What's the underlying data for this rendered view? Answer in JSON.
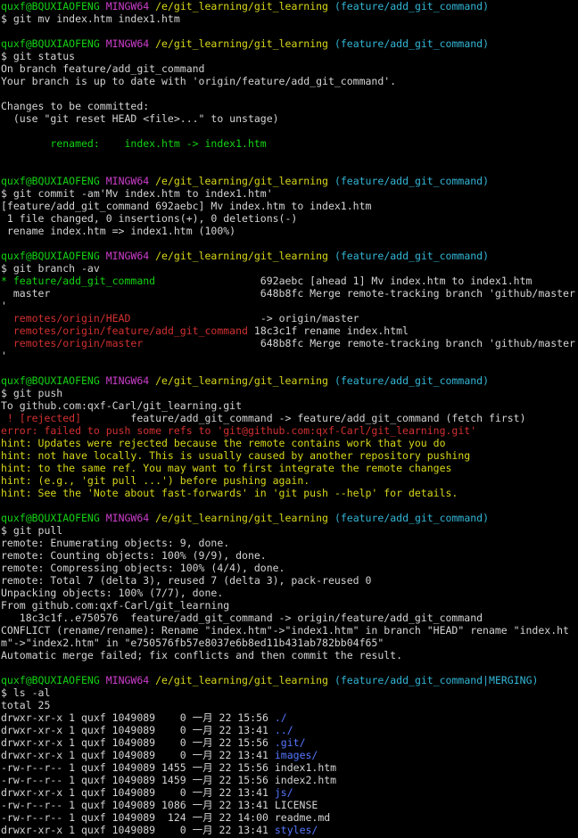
{
  "colors": {
    "background": "#000000",
    "text": "#d4d4d4",
    "prompt_user": "#14d314",
    "prompt_shell": "#cc3ecc",
    "prompt_path": "#d7d71a",
    "prompt_branch": "#33b6d6",
    "error": "#d23030",
    "directory": "#5577ff"
  },
  "terminal": {
    "lines": [
      {
        "segments": [
          {
            "text": "quxf@BQUXIAOFENG",
            "color": "green"
          },
          {
            "text": " "
          },
          {
            "text": "MINGW64",
            "color": "magenta"
          },
          {
            "text": " "
          },
          {
            "text": "/e/git_learning/git_learning",
            "color": "yellow"
          },
          {
            "text": " "
          },
          {
            "text": "(feature/add_git_command)",
            "color": "cyan"
          }
        ]
      },
      {
        "segments": [
          {
            "text": "$ git mv index.htm index1.htm"
          }
        ]
      },
      {
        "segments": [
          {
            "text": ""
          }
        ]
      },
      {
        "segments": [
          {
            "text": "quxf@BQUXIAOFENG",
            "color": "green"
          },
          {
            "text": " "
          },
          {
            "text": "MINGW64",
            "color": "magenta"
          },
          {
            "text": " "
          },
          {
            "text": "/e/git_learning/git_learning",
            "color": "yellow"
          },
          {
            "text": " "
          },
          {
            "text": "(feature/add_git_command)",
            "color": "cyan"
          }
        ]
      },
      {
        "segments": [
          {
            "text": "$ git status"
          }
        ]
      },
      {
        "segments": [
          {
            "text": "On branch feature/add_git_command"
          }
        ]
      },
      {
        "segments": [
          {
            "text": "Your branch is up to date with 'origin/feature/add_git_command'."
          }
        ]
      },
      {
        "segments": [
          {
            "text": ""
          }
        ]
      },
      {
        "segments": [
          {
            "text": "Changes to be committed:"
          }
        ]
      },
      {
        "segments": [
          {
            "text": "  (use \"git reset HEAD <file>...\" to unstage)"
          }
        ]
      },
      {
        "segments": [
          {
            "text": ""
          }
        ]
      },
      {
        "segments": [
          {
            "text": "        "
          },
          {
            "text": "renamed:    index.htm -> index1.htm",
            "color": "green"
          }
        ]
      },
      {
        "segments": [
          {
            "text": ""
          }
        ]
      },
      {
        "segments": [
          {
            "text": ""
          }
        ]
      },
      {
        "segments": [
          {
            "text": "quxf@BQUXIAOFENG",
            "color": "green"
          },
          {
            "text": " "
          },
          {
            "text": "MINGW64",
            "color": "magenta"
          },
          {
            "text": " "
          },
          {
            "text": "/e/git_learning/git_learning",
            "color": "yellow"
          },
          {
            "text": " "
          },
          {
            "text": "(feature/add_git_command)",
            "color": "cyan"
          }
        ]
      },
      {
        "segments": [
          {
            "text": "$ git commit -am'Mv index.htm to index1.htm'"
          }
        ]
      },
      {
        "segments": [
          {
            "text": "[feature/add_git_command 692aebc] Mv index.htm to index1.htm"
          }
        ]
      },
      {
        "segments": [
          {
            "text": " 1 file changed, 0 insertions(+), 0 deletions(-)"
          }
        ]
      },
      {
        "segments": [
          {
            "text": " rename index.htm => index1.htm (100%)"
          }
        ]
      },
      {
        "segments": [
          {
            "text": ""
          }
        ]
      },
      {
        "segments": [
          {
            "text": "quxf@BQUXIAOFENG",
            "color": "green"
          },
          {
            "text": " "
          },
          {
            "text": "MINGW64",
            "color": "magenta"
          },
          {
            "text": " "
          },
          {
            "text": "/e/git_learning/git_learning",
            "color": "yellow"
          },
          {
            "text": " "
          },
          {
            "text": "(feature/add_git_command)",
            "color": "cyan"
          }
        ]
      },
      {
        "segments": [
          {
            "text": "$ git branch -av"
          }
        ]
      },
      {
        "segments": [
          {
            "text": "* feature/add_git_command",
            "color": "green"
          },
          {
            "text": "                 692aebc [ahead 1] Mv index.htm to index1.htm"
          }
        ]
      },
      {
        "segments": [
          {
            "text": "  master                                  648b8fc Merge remote-tracking branch 'github/master"
          }
        ]
      },
      {
        "segments": [
          {
            "text": "'"
          }
        ]
      },
      {
        "segments": [
          {
            "text": "  "
          },
          {
            "text": "remotes/origin/HEAD",
            "color": "red"
          },
          {
            "text": "                     -> origin/master"
          }
        ]
      },
      {
        "segments": [
          {
            "text": "  "
          },
          {
            "text": "remotes/origin/feature/add_git_command",
            "color": "red"
          },
          {
            "text": " 18c3c1f rename index.html"
          }
        ]
      },
      {
        "segments": [
          {
            "text": "  "
          },
          {
            "text": "remotes/origin/master",
            "color": "red"
          },
          {
            "text": "                   648b8fc Merge remote-tracking branch 'github/master"
          }
        ]
      },
      {
        "segments": [
          {
            "text": "'"
          }
        ]
      },
      {
        "segments": [
          {
            "text": ""
          }
        ]
      },
      {
        "segments": [
          {
            "text": "quxf@BQUXIAOFENG",
            "color": "green"
          },
          {
            "text": " "
          },
          {
            "text": "MINGW64",
            "color": "magenta"
          },
          {
            "text": " "
          },
          {
            "text": "/e/git_learning/git_learning",
            "color": "yellow"
          },
          {
            "text": " "
          },
          {
            "text": "(feature/add_git_command)",
            "color": "cyan"
          }
        ]
      },
      {
        "segments": [
          {
            "text": "$ git push"
          }
        ]
      },
      {
        "segments": [
          {
            "text": "To github.com:qxf-Carl/git_learning.git"
          }
        ]
      },
      {
        "segments": [
          {
            "text": " ! [rejected]",
            "color": "red"
          },
          {
            "text": "        feature/add_git_command -> feature/add_git_command (fetch first)"
          }
        ]
      },
      {
        "segments": [
          {
            "text": "error: failed to push some refs to 'git@github.com:qxf-Carl/git_learning.git'",
            "color": "red"
          }
        ]
      },
      {
        "segments": [
          {
            "text": "hint: Updates were rejected because the remote contains work that you do",
            "color": "yellow"
          }
        ]
      },
      {
        "segments": [
          {
            "text": "hint: not have locally. This is usually caused by another repository pushing",
            "color": "yellow"
          }
        ]
      },
      {
        "segments": [
          {
            "text": "hint: to the same ref. You may want to first integrate the remote changes",
            "color": "yellow"
          }
        ]
      },
      {
        "segments": [
          {
            "text": "hint: (e.g., 'git pull ...') before pushing again.",
            "color": "yellow"
          }
        ]
      },
      {
        "segments": [
          {
            "text": "hint: See the 'Note about fast-forwards' in 'git push --help' for details.",
            "color": "yellow"
          }
        ]
      },
      {
        "segments": [
          {
            "text": ""
          }
        ]
      },
      {
        "segments": [
          {
            "text": "quxf@BQUXIAOFENG",
            "color": "green"
          },
          {
            "text": " "
          },
          {
            "text": "MINGW64",
            "color": "magenta"
          },
          {
            "text": " "
          },
          {
            "text": "/e/git_learning/git_learning",
            "color": "yellow"
          },
          {
            "text": " "
          },
          {
            "text": "(feature/add_git_command)",
            "color": "cyan"
          }
        ]
      },
      {
        "segments": [
          {
            "text": "$ git pull"
          }
        ]
      },
      {
        "segments": [
          {
            "text": "remote: Enumerating objects: 9, done."
          }
        ]
      },
      {
        "segments": [
          {
            "text": "remote: Counting objects: 100% (9/9), done."
          }
        ]
      },
      {
        "segments": [
          {
            "text": "remote: Compressing objects: 100% (4/4), done."
          }
        ]
      },
      {
        "segments": [
          {
            "text": "remote: Total 7 (delta 3), reused 7 (delta 3), pack-reused 0"
          }
        ]
      },
      {
        "segments": [
          {
            "text": "Unpacking objects: 100% (7/7), done."
          }
        ]
      },
      {
        "segments": [
          {
            "text": "From github.com:qxf-Carl/git_learning"
          }
        ]
      },
      {
        "segments": [
          {
            "text": "   18c3c1f..e750576  feature/add_git_command -> origin/feature/add_git_command"
          }
        ]
      },
      {
        "segments": [
          {
            "text": "CONFLICT (rename/rename): Rename \"index.htm\"->\"index1.htm\" in branch \"HEAD\" rename \"index.ht"
          }
        ]
      },
      {
        "segments": [
          {
            "text": "m\"->\"index2.htm\" in \"e750576fb57e8037e6b8ed11b431ab782bb04f65\""
          }
        ]
      },
      {
        "segments": [
          {
            "text": "Automatic merge failed; fix conflicts and then commit the result."
          }
        ]
      },
      {
        "segments": [
          {
            "text": ""
          }
        ]
      },
      {
        "segments": [
          {
            "text": "quxf@BQUXIAOFENG",
            "color": "green"
          },
          {
            "text": " "
          },
          {
            "text": "MINGW64",
            "color": "magenta"
          },
          {
            "text": " "
          },
          {
            "text": "/e/git_learning/git_learning",
            "color": "yellow"
          },
          {
            "text": " "
          },
          {
            "text": "(feature/add_git_command|MERGING)",
            "color": "cyan"
          }
        ]
      },
      {
        "segments": [
          {
            "text": "$ ls -al"
          }
        ]
      },
      {
        "segments": [
          {
            "text": "total 25"
          }
        ]
      },
      {
        "segments": [
          {
            "text": "drwxr-xr-x 1 quxf 1049089    0 一月 22 15:56 "
          },
          {
            "text": "./",
            "color": "blue"
          }
        ]
      },
      {
        "segments": [
          {
            "text": "drwxr-xr-x 1 quxf 1049089    0 一月 22 13:41 "
          },
          {
            "text": "../",
            "color": "blue"
          }
        ]
      },
      {
        "segments": [
          {
            "text": "drwxr-xr-x 1 quxf 1049089    0 一月 22 15:56 "
          },
          {
            "text": ".git/",
            "color": "blue"
          }
        ]
      },
      {
        "segments": [
          {
            "text": "drwxr-xr-x 1 quxf 1049089    0 一月 22 13:41 "
          },
          {
            "text": "images/",
            "color": "blue"
          }
        ]
      },
      {
        "segments": [
          {
            "text": "-rw-r--r-- 1 quxf 1049089 1455 一月 22 15:56 index1.htm"
          }
        ]
      },
      {
        "segments": [
          {
            "text": "-rw-r--r-- 1 quxf 1049089 1459 一月 22 15:56 index2.htm"
          }
        ]
      },
      {
        "segments": [
          {
            "text": "drwxr-xr-x 1 quxf 1049089    0 一月 22 13:41 "
          },
          {
            "text": "js/",
            "color": "blue"
          }
        ]
      },
      {
        "segments": [
          {
            "text": "-rw-r--r-- 1 quxf 1049089 1086 一月 22 13:41 LICENSE"
          }
        ]
      },
      {
        "segments": [
          {
            "text": "-rw-r--r-- 1 quxf 1049089  124 一月 22 14:00 readme.md"
          }
        ]
      },
      {
        "segments": [
          {
            "text": "drwxr-xr-x 1 quxf 1049089    0 一月 22 13:41 "
          },
          {
            "text": "styles/",
            "color": "blue"
          }
        ]
      }
    ]
  }
}
